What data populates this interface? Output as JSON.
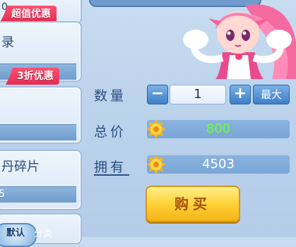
{
  "items": [
    {
      "name": "0",
      "tag": "超值优惠",
      "sub": ""
    },
    {
      "name": "录",
      "tag": "3折优惠",
      "sub": ""
    },
    {
      "name": "",
      "tag": "",
      "sub": ""
    },
    {
      "name": "丹碎片",
      "tag": "",
      "sub": "5"
    }
  ],
  "tabs": {
    "default_label": "默认",
    "category_label": "分类"
  },
  "purchase": {
    "quantity_label": "数量",
    "quantity_value": "1",
    "minus_label": "−",
    "plus_label": "+",
    "max_label": "最大",
    "total_label": "总价",
    "total_value": "800",
    "owned_label": "拥有",
    "owned_value": "4503",
    "buy_label": "购买"
  },
  "colors": {
    "total_value_color": "#6cff3a",
    "owned_value_color": "#ffffff",
    "tag_color": "#e8365a",
    "buy_button_color": "#ffd23a"
  },
  "icons": {
    "currency": "gold-coin-icon",
    "character": "mascot-girl-portrait"
  }
}
